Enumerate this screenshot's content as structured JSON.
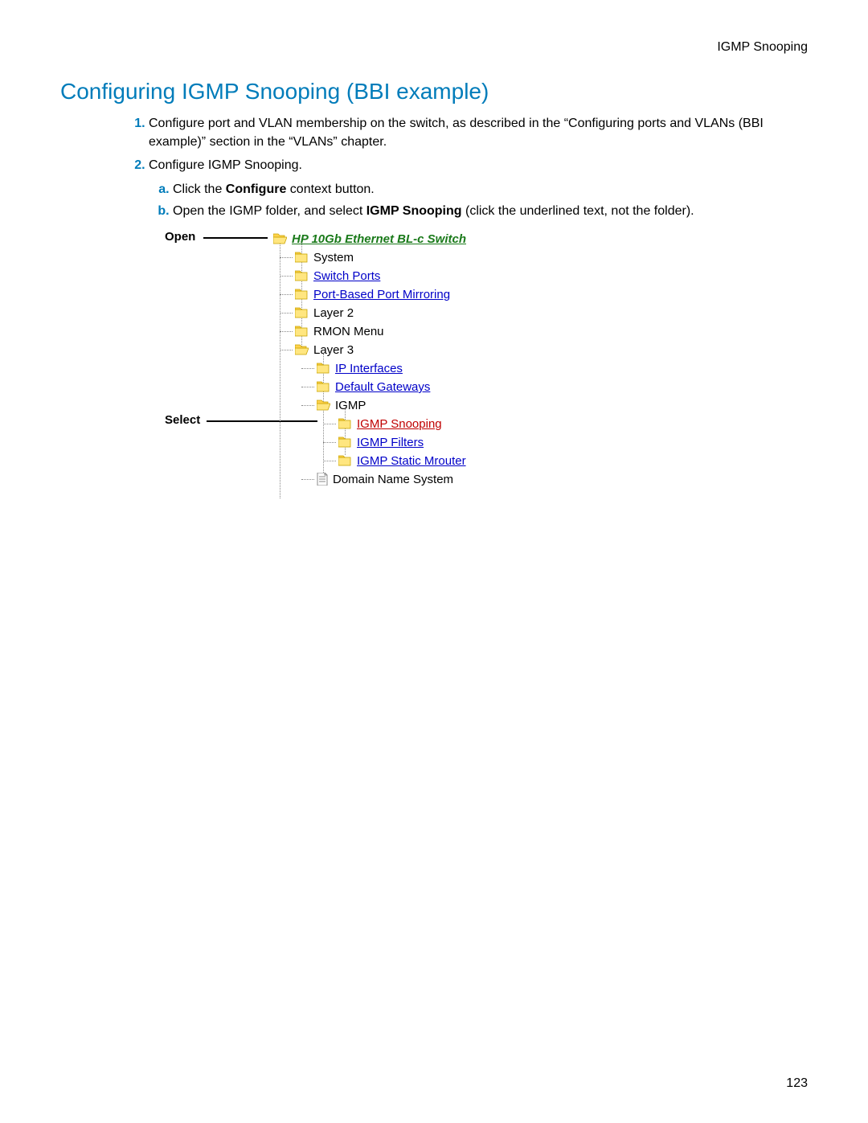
{
  "header": {
    "right": "IGMP Snooping"
  },
  "title": "Configuring IGMP Snooping (BBI example)",
  "steps": {
    "s1": "Configure port and VLAN membership on the switch, as described in the “Configuring ports and VLANs (BBI example)” section in the “VLANs” chapter.",
    "s2": "Configure IGMP Snooping.",
    "s2a_pre": "Click the ",
    "s2a_bold": "Configure",
    "s2a_post": " context button.",
    "s2b_pre": "Open the IGMP folder, and select ",
    "s2b_bold": "IGMP Snooping",
    "s2b_post": " (click the underlined text, not the folder)."
  },
  "callouts": {
    "open": "Open",
    "select": "Select"
  },
  "tree": {
    "root": "HP 10Gb Ethernet BL-c Switch",
    "n1": "System",
    "n2": "Switch Ports",
    "n3": "Port-Based Port Mirroring",
    "n4": "Layer 2",
    "n5": "RMON Menu",
    "n6": "Layer 3",
    "l3_1": "IP Interfaces",
    "l3_2": "Default Gateways",
    "l3_3": "IGMP",
    "igmp_1": "IGMP Snooping",
    "igmp_2": "IGMP Filters",
    "igmp_3": "IGMP Static Mrouter",
    "dns": "Domain Name System"
  },
  "page_number": "123"
}
